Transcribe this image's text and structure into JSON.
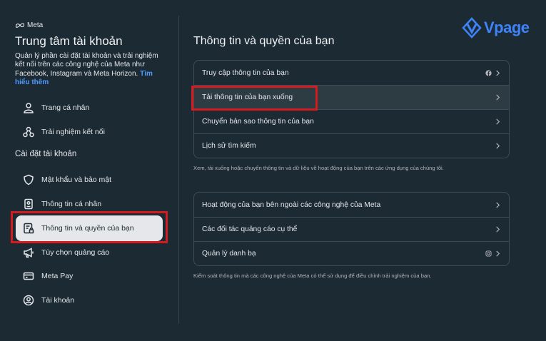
{
  "brand": {
    "meta_label": "Meta",
    "watermark_text": "Vpage"
  },
  "sidebar": {
    "title": "Trung tâm tài khoản",
    "description": "Quản lý phần cài đặt tài khoản và trải nghiệm kết nối trên các công nghệ của Meta như Facebook, Instagram và Meta Horizon.",
    "learn_more": "Tìm hiểu thêm",
    "top_items": [
      {
        "label": "Trang cá nhân",
        "icon": "person-icon"
      },
      {
        "label": "Trải nghiệm kết nối",
        "icon": "connected-icon"
      }
    ],
    "section_label": "Cài đặt tài khoản",
    "settings_items": [
      {
        "label": "Mật khẩu và bảo mật",
        "icon": "shield-icon"
      },
      {
        "label": "Thông tin cá nhân",
        "icon": "id-card-icon"
      },
      {
        "label": "Thông tin và quyền của bạn",
        "icon": "document-lock-icon",
        "active": true
      },
      {
        "label": "Tùy chọn quảng cáo",
        "icon": "megaphone-icon"
      },
      {
        "label": "Meta Pay",
        "icon": "card-icon"
      },
      {
        "label": "Tài khoản",
        "icon": "account-icon"
      }
    ]
  },
  "main": {
    "title": "Thông tin và quyền của bạn",
    "group1": {
      "rows": [
        {
          "label": "Truy cập thông tin của bạn",
          "icon": "facebook-icon"
        },
        {
          "label": "Tải thông tin của bạn xuống"
        },
        {
          "label": "Chuyển bản sao thông tin của bạn"
        },
        {
          "label": "Lịch sử tìm kiếm"
        }
      ],
      "note": "Xem, tải xuống hoặc chuyển thông tin và dữ liệu về hoạt động của bạn trên các ứng dụng của chúng tôi."
    },
    "group2": {
      "rows": [
        {
          "label": "Hoạt động của bạn bên ngoài các công nghệ của Meta"
        },
        {
          "label": "Các đối tác quảng cáo cụ thể"
        },
        {
          "label": "Quản lý danh bạ",
          "icon": "instagram-icon"
        }
      ],
      "note": "Kiểm soát thông tin mà các công nghệ của Meta có thể sử dụng để điều chỉnh trải nghiệm của bạn."
    }
  },
  "colors": {
    "background": "#1c2b33",
    "highlight_red": "#d41b1f",
    "link_blue": "#4e9bff"
  }
}
